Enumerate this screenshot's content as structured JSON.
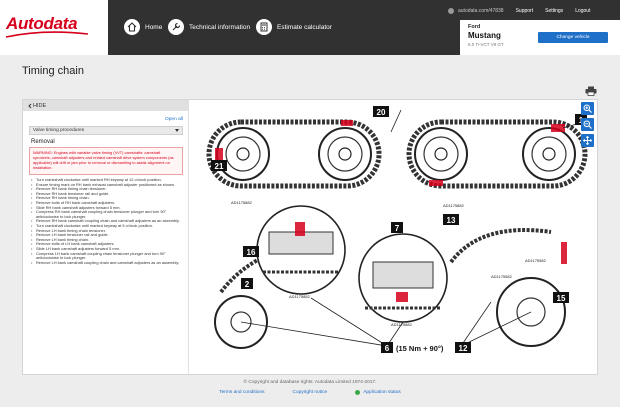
{
  "brand": {
    "logo": "Autodata",
    "accent": "#d6001c",
    "primary": "#1e6fc8"
  },
  "nav": [
    {
      "label": "Home",
      "icon": "home-icon"
    },
    {
      "label": "Technical information",
      "icon": "wrench-icon"
    },
    {
      "label": "Estimate calculator",
      "icon": "calculator-icon"
    }
  ],
  "top_links": {
    "user": "autodata.com/47838",
    "support": "Support",
    "settings": "Settings",
    "logout": "Logout"
  },
  "vehicle": {
    "make": "Ford",
    "model": "Mustang",
    "engine": "5.0 Ti-VCT V8 GT",
    "change_label": "Change vehicle"
  },
  "page": {
    "title": "Timing chain"
  },
  "sidebar": {
    "hide_label": "HIDE",
    "open_all": "Open all",
    "select_value": "Valve timing procedures",
    "section_title": "Removal",
    "warning": "WARNING: Engines with variable valve timing (VVT) camshafts: camshaft sprockets, camshaft adjusters and related camshaft drive system components (as applicable) will drift or jam prior to removal or dismantling to assist alignment on installation.",
    "steps": [
      "Turn crankshaft clockwise until marked RH keyway at 12 o'clock position.",
      "Ensure timing mark on RH bank exhaust camshaft adjuster positioned as shown.",
      "Remove RH bank timing chain tensioner.",
      "Remove RH bank tensioner rail and guide.",
      "Remove RH bank timing chain.",
      "Remove bolts of RH bank camshaft adjusters.",
      "Slide RH bank camshaft adjusters forward 5 mm.",
      "Compress RH bank camshaft coupling chain tensioner plunger and turn 90° anticlockwise to lock plunger.",
      "Remove RH bank camshaft coupling chain and camshaft adjusters as an assembly.",
      "Turn crankshaft clockwise until marked keyway at 5 o'clock position.",
      "Remove LH bank timing chain tensioner.",
      "Remove LH bank tensioner rail and guide.",
      "Remove LH bank timing chain.",
      "Remove bolts of LH bank camshaft adjusters.",
      "Slide LH bank camshaft adjusters forward 5 mm.",
      "Compress LH bank camshaft coupling chain tensioner plunger and turn 90° anticlockwise to lock plunger.",
      "Remove LH bank camshaft coupling chain and camshaft adjusters as an assembly."
    ]
  },
  "diagram": {
    "callouts": [
      {
        "n": "1"
      },
      {
        "n": "20"
      },
      {
        "n": "21"
      },
      {
        "n": "13"
      },
      {
        "n": "16"
      },
      {
        "n": "7"
      },
      {
        "n": "2"
      },
      {
        "n": "15"
      },
      {
        "n": "6",
        "extra": "(15 Nm + 90°)"
      },
      {
        "n": "12"
      }
    ],
    "refs": [
      "AD1175882",
      "AD1175882",
      "AD1175582",
      "AD1175882",
      "AD1175882",
      "AD1175582"
    ]
  },
  "footer": {
    "copyright": "© Copyright and database rights: Autodata Limited 1974-2017.",
    "terms": "Terms and conditions",
    "copyright_notice": "Copyright notice",
    "status": "Application status"
  }
}
